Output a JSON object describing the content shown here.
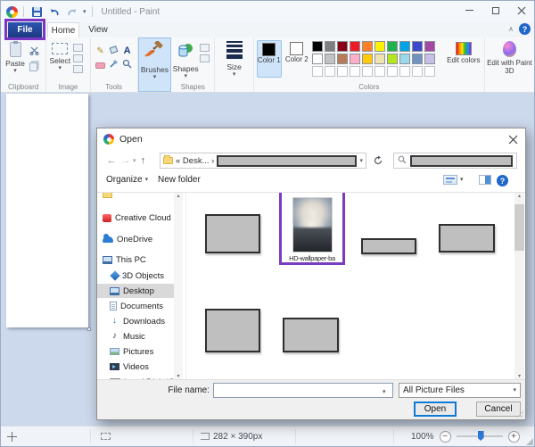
{
  "icons": {
    "back": "←",
    "forward": "→",
    "up": "↑",
    "dropdown": "▾",
    "small_chevron": "▾",
    "scroll_up": "▴",
    "scroll_down": "▾",
    "download": "↓",
    "music": "♪",
    "pencil": "✎",
    "help": "?",
    "minus": "−",
    "plus": "+",
    "collapse": "∧"
  },
  "app": {
    "titlebar": {
      "title": "Untitled - Paint"
    },
    "tabs": {
      "file": "File",
      "home": "Home",
      "view": "View"
    },
    "ribbon": {
      "clipboard": {
        "group_label": "Clipboard",
        "paste_label": "Paste"
      },
      "image": {
        "group_label": "Image",
        "select_label": "Select"
      },
      "tools": {
        "group_label": "Tools",
        "text_tool": "A"
      },
      "brushes": {
        "label": "Brushes"
      },
      "shapes": {
        "group_label": "Shapes",
        "label": "Shapes"
      },
      "size": {
        "label": "Size"
      },
      "colors": {
        "group_label": "Colors",
        "color1_label": "Color 1",
        "color2_label": "Color 2",
        "color1_value": "#000000",
        "color2_value": "#ffffff",
        "edit_colors_label": "Edit colors",
        "palette_row1": [
          "#000000",
          "#7f7f7f",
          "#880015",
          "#ed1c24",
          "#ff7f27",
          "#fff200",
          "#22b14c",
          "#00a2e8",
          "#3f48cc",
          "#a349a4"
        ],
        "palette_row2": [
          "#ffffff",
          "#c3c3c3",
          "#b97a57",
          "#ffaec9",
          "#ffc90e",
          "#efe4b0",
          "#b5e61d",
          "#99d9ea",
          "#7092be",
          "#c8bfe7"
        ],
        "palette_empty_count": 10
      },
      "paint3d": {
        "label": "Edit with Paint 3D"
      }
    },
    "statusbar": {
      "canvas_size": "282 × 390px",
      "zoom_level": "100%"
    }
  },
  "dialog": {
    "title": "Open",
    "nav": {
      "breadcrumb": "« Desk... ›"
    },
    "toolbar": {
      "organize_label": "Organize",
      "new_folder_label": "New folder"
    },
    "sidebar": {
      "items": [
        {
          "label": "Creative Cloud Fil"
        },
        {
          "label": "OneDrive"
        },
        {
          "label": "This PC"
        },
        {
          "label": "3D Objects"
        },
        {
          "label": "Desktop"
        },
        {
          "label": "Documents"
        },
        {
          "label": "Downloads"
        },
        {
          "label": "Music"
        },
        {
          "label": "Pictures"
        },
        {
          "label": "Videos"
        },
        {
          "label": "Local Disk (C:)"
        }
      ]
    },
    "files": {
      "selected_file_label": "HD-wallpaper-ba"
    },
    "footer": {
      "file_name_label": "File name:",
      "file_name_value": "",
      "file_type_value": "All Picture Files",
      "open_label": "Open",
      "cancel_label": "Cancel"
    }
  }
}
